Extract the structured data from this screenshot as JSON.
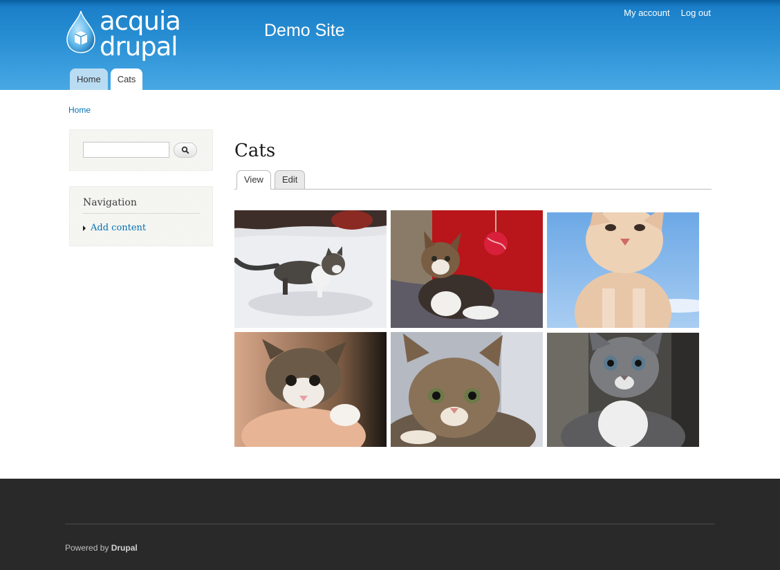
{
  "header": {
    "logo_text": "acquia drupal",
    "site_name": "Demo Site",
    "secondary_menu": [
      "My account",
      "Log out"
    ],
    "main_menu": [
      {
        "label": "Home",
        "active": false
      },
      {
        "label": "Cats",
        "active": true
      }
    ]
  },
  "breadcrumb": {
    "home": "Home"
  },
  "sidebar": {
    "search": {
      "value": "",
      "button_icon": "search-icon"
    },
    "navigation": {
      "title": "Navigation",
      "items": [
        "Add content"
      ]
    }
  },
  "content": {
    "title": "Cats",
    "tabs": [
      {
        "label": "View",
        "active": true
      },
      {
        "label": "Edit",
        "active": false
      }
    ],
    "images": [
      {
        "name": "kitten-in-snow"
      },
      {
        "name": "calico-kitten-with-yarn-ball"
      },
      {
        "name": "cream-kitten-sky"
      },
      {
        "name": "tabby-kitten-in-hand"
      },
      {
        "name": "tabby-kitten-closeup"
      },
      {
        "name": "gray-tabby-kitten"
      }
    ]
  },
  "footer": {
    "powered_prefix": "Powered by",
    "powered_link": "Drupal"
  },
  "colors": {
    "header_blue": "#2a90d4",
    "link": "#0071b3",
    "footer_bg": "#292929"
  }
}
